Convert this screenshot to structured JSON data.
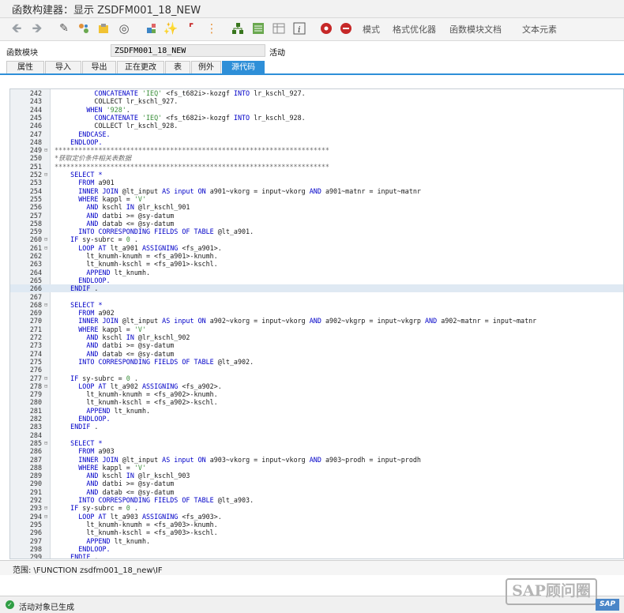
{
  "window": {
    "title": "函数构建器：显示 ZSDFM001_18_NEW"
  },
  "toolbar": {
    "icons": [
      "back-arrow-icon",
      "forward-arrow-icon",
      "other-object-icon",
      "switch-display-change-icon",
      "active-inactive-icon",
      "check-icon",
      "activate-icon",
      "test-icon",
      "where-used-icon",
      "display-object-list-icon",
      "navigation-window-icon",
      "pattern-icon",
      "insert-icon",
      "info-icon",
      "breakpoint-icon",
      "session-breakpoint-icon"
    ],
    "text_buttons": [
      "模式",
      "格式优化器",
      "函数模块文档",
      "文本元素"
    ],
    "colors": {
      "breakpoint": "#c62828",
      "accent": "#2e8fd8"
    }
  },
  "field": {
    "label": "函数模块",
    "value": "ZSDFM001_18_NEW",
    "status": "活动"
  },
  "tabs": [
    "属性",
    "导入",
    "导出",
    "正在更改",
    "表",
    "例外",
    "源代码"
  ],
  "active_tab": "源代码",
  "code": {
    "current_line": 266,
    "lines": [
      {
        "n": "242",
        "t": [
          [
            "          ",
            ""
          ],
          [
            "CONCATENATE",
            "kw"
          ],
          [
            " ",
            ""
          ],
          [
            "'IEQ'",
            "st"
          ],
          [
            " <fs_t682i>-kozgf ",
            ""
          ],
          [
            "INTO",
            "kw"
          ],
          [
            " lr_kschl_927.",
            ""
          ]
        ]
      },
      {
        "n": "243",
        "t": [
          [
            "          COLLECT lr_kschl_927.",
            ""
          ]
        ]
      },
      {
        "n": "244",
        "t": [
          [
            "        ",
            ""
          ],
          [
            "WHEN",
            "kw"
          ],
          [
            " ",
            ""
          ],
          [
            "'928'",
            "st"
          ],
          [
            ".",
            ""
          ]
        ]
      },
      {
        "n": "245",
        "t": [
          [
            "          ",
            ""
          ],
          [
            "CONCATENATE",
            "kw"
          ],
          [
            " ",
            ""
          ],
          [
            "'IEQ'",
            "st"
          ],
          [
            " <fs_t682i>-kozgf ",
            ""
          ],
          [
            "INTO",
            "kw"
          ],
          [
            " lr_kschl_928.",
            ""
          ]
        ]
      },
      {
        "n": "246",
        "t": [
          [
            "          COLLECT lr_kschl_928.",
            ""
          ]
        ]
      },
      {
        "n": "247",
        "t": [
          [
            "      ",
            ""
          ],
          [
            "ENDCASE.",
            "kw"
          ]
        ]
      },
      {
        "n": "248",
        "t": [
          [
            "    ",
            ""
          ],
          [
            "ENDLOOP.",
            "kw"
          ]
        ]
      },
      {
        "n": "249",
        "t": [
          [
            "*********************************************************************",
            "cm"
          ]
        ],
        "fold": "⊟"
      },
      {
        "n": "250",
        "t": [
          [
            "*获取定价条件相关表数据",
            "cm"
          ]
        ]
      },
      {
        "n": "251",
        "t": [
          [
            "*********************************************************************",
            "cm"
          ]
        ]
      },
      {
        "n": "252",
        "t": [
          [
            "    ",
            ""
          ],
          [
            "SELECT *",
            "kw"
          ]
        ],
        "fold": "⊟"
      },
      {
        "n": "253",
        "t": [
          [
            "      ",
            ""
          ],
          [
            "FROM",
            "kw"
          ],
          [
            " a901",
            ""
          ]
        ]
      },
      {
        "n": "254",
        "t": [
          [
            "      ",
            ""
          ],
          [
            "INNER JOIN",
            "kw"
          ],
          [
            " @lt_input ",
            ""
          ],
          [
            "AS",
            "kw"
          ],
          [
            " ",
            ""
          ],
          [
            "input",
            "kw"
          ],
          [
            " ",
            ""
          ],
          [
            "ON",
            "kw"
          ],
          [
            " a901~vkorg = input~vkorg ",
            ""
          ],
          [
            "AND",
            "kw"
          ],
          [
            " a901~matnr = input~matnr",
            ""
          ]
        ]
      },
      {
        "n": "255",
        "t": [
          [
            "      ",
            ""
          ],
          [
            "WHERE",
            "kw"
          ],
          [
            " kappl = ",
            ""
          ],
          [
            "'V'",
            "st"
          ]
        ]
      },
      {
        "n": "256",
        "t": [
          [
            "        ",
            ""
          ],
          [
            "AND",
            "kw"
          ],
          [
            " kschl ",
            ""
          ],
          [
            "IN",
            "kw"
          ],
          [
            " @lr_kschl_901",
            ""
          ]
        ]
      },
      {
        "n": "257",
        "t": [
          [
            "        ",
            ""
          ],
          [
            "AND",
            "kw"
          ],
          [
            " datbi >= @sy-datum",
            ""
          ]
        ]
      },
      {
        "n": "258",
        "t": [
          [
            "        ",
            ""
          ],
          [
            "AND",
            "kw"
          ],
          [
            " datab <= @sy-datum",
            ""
          ]
        ]
      },
      {
        "n": "259",
        "t": [
          [
            "      ",
            ""
          ],
          [
            "INTO CORRESPONDING FIELDS OF TABLE",
            "kw"
          ],
          [
            " @lt_a901.",
            ""
          ]
        ]
      },
      {
        "n": "260",
        "t": [
          [
            "    ",
            ""
          ],
          [
            "IF",
            "kw"
          ],
          [
            " sy-subrc = ",
            ""
          ],
          [
            "0",
            "st"
          ],
          [
            " .",
            ""
          ]
        ],
        "fold": "⊟"
      },
      {
        "n": "261",
        "t": [
          [
            "      ",
            ""
          ],
          [
            "LOOP AT",
            "kw"
          ],
          [
            " lt_a901 ",
            ""
          ],
          [
            "ASSIGNING",
            "kw"
          ],
          [
            " <fs_a901>.",
            ""
          ]
        ],
        "fold": "⊟"
      },
      {
        "n": "262",
        "t": [
          [
            "        lt_knumh-knumh = <fs_a901>-knumh.",
            ""
          ]
        ]
      },
      {
        "n": "263",
        "t": [
          [
            "        lt_knumh-kschl = <fs_a901>-kschl.",
            ""
          ]
        ]
      },
      {
        "n": "264",
        "t": [
          [
            "        ",
            ""
          ],
          [
            "APPEND",
            "kw"
          ],
          [
            " lt_knumh.",
            ""
          ]
        ]
      },
      {
        "n": "265",
        "t": [
          [
            "      ",
            ""
          ],
          [
            "ENDLOOP.",
            "kw"
          ]
        ]
      },
      {
        "n": "266",
        "t": [
          [
            "    ",
            ""
          ],
          [
            "ENDIF",
            "kw"
          ],
          [
            " .",
            ""
          ]
        ]
      },
      {
        "n": "267",
        "t": [
          [
            "",
            ""
          ]
        ]
      },
      {
        "n": "268",
        "t": [
          [
            "    ",
            ""
          ],
          [
            "SELECT *",
            "kw"
          ]
        ],
        "fold": "⊟"
      },
      {
        "n": "269",
        "t": [
          [
            "      ",
            ""
          ],
          [
            "FROM",
            "kw"
          ],
          [
            " a902",
            ""
          ]
        ]
      },
      {
        "n": "270",
        "t": [
          [
            "      ",
            ""
          ],
          [
            "INNER JOIN",
            "kw"
          ],
          [
            " @lt_input ",
            ""
          ],
          [
            "AS",
            "kw"
          ],
          [
            " ",
            ""
          ],
          [
            "input",
            "kw"
          ],
          [
            " ",
            ""
          ],
          [
            "ON",
            "kw"
          ],
          [
            " a902~vkorg = input~vkorg ",
            ""
          ],
          [
            "AND",
            "kw"
          ],
          [
            " a902~vkgrp = input~vkgrp ",
            ""
          ],
          [
            "AND",
            "kw"
          ],
          [
            " a902~matnr = input~matnr",
            ""
          ]
        ]
      },
      {
        "n": "271",
        "t": [
          [
            "      ",
            ""
          ],
          [
            "WHERE",
            "kw"
          ],
          [
            " kappl = ",
            ""
          ],
          [
            "'V'",
            "st"
          ]
        ]
      },
      {
        "n": "272",
        "t": [
          [
            "        ",
            ""
          ],
          [
            "AND",
            "kw"
          ],
          [
            " kschl ",
            ""
          ],
          [
            "IN",
            "kw"
          ],
          [
            " @lr_kschl_902",
            ""
          ]
        ]
      },
      {
        "n": "273",
        "t": [
          [
            "        ",
            ""
          ],
          [
            "AND",
            "kw"
          ],
          [
            " datbi >= @sy-datum",
            ""
          ]
        ]
      },
      {
        "n": "274",
        "t": [
          [
            "        ",
            ""
          ],
          [
            "AND",
            "kw"
          ],
          [
            " datab <= @sy-datum",
            ""
          ]
        ]
      },
      {
        "n": "275",
        "t": [
          [
            "      ",
            ""
          ],
          [
            "INTO CORRESPONDING FIELDS OF TABLE",
            "kw"
          ],
          [
            " @lt_a902.",
            ""
          ]
        ]
      },
      {
        "n": "276",
        "t": [
          [
            "",
            ""
          ]
        ]
      },
      {
        "n": "277",
        "t": [
          [
            "    ",
            ""
          ],
          [
            "IF",
            "kw"
          ],
          [
            " sy-subrc = ",
            ""
          ],
          [
            "0",
            "st"
          ],
          [
            " .",
            ""
          ]
        ],
        "fold": "⊟"
      },
      {
        "n": "278",
        "t": [
          [
            "      ",
            ""
          ],
          [
            "LOOP AT",
            "kw"
          ],
          [
            " lt_a902 ",
            ""
          ],
          [
            "ASSIGNING",
            "kw"
          ],
          [
            " <fs_a902>.",
            ""
          ]
        ],
        "fold": "⊟"
      },
      {
        "n": "279",
        "t": [
          [
            "        lt_knumh-knumh = <fs_a902>-knumh.",
            ""
          ]
        ]
      },
      {
        "n": "280",
        "t": [
          [
            "        lt_knumh-kschl = <fs_a902>-kschl.",
            ""
          ]
        ]
      },
      {
        "n": "281",
        "t": [
          [
            "        ",
            ""
          ],
          [
            "APPEND",
            "kw"
          ],
          [
            " lt_knumh.",
            ""
          ]
        ]
      },
      {
        "n": "282",
        "t": [
          [
            "      ",
            ""
          ],
          [
            "ENDLOOP.",
            "kw"
          ]
        ]
      },
      {
        "n": "283",
        "t": [
          [
            "    ",
            ""
          ],
          [
            "ENDIF",
            "kw"
          ],
          [
            " .",
            ""
          ]
        ]
      },
      {
        "n": "284",
        "t": [
          [
            "",
            ""
          ]
        ]
      },
      {
        "n": "285",
        "t": [
          [
            "    ",
            ""
          ],
          [
            "SELECT *",
            "kw"
          ]
        ],
        "fold": "⊟"
      },
      {
        "n": "286",
        "t": [
          [
            "      ",
            ""
          ],
          [
            "FROM",
            "kw"
          ],
          [
            " a903",
            ""
          ]
        ]
      },
      {
        "n": "287",
        "t": [
          [
            "      ",
            ""
          ],
          [
            "INNER JOIN",
            "kw"
          ],
          [
            " @lt_input ",
            ""
          ],
          [
            "AS",
            "kw"
          ],
          [
            " ",
            ""
          ],
          [
            "input",
            "kw"
          ],
          [
            " ",
            ""
          ],
          [
            "ON",
            "kw"
          ],
          [
            " a903~vkorg = input~vkorg ",
            ""
          ],
          [
            "AND",
            "kw"
          ],
          [
            " a903~prodh = input~prodh",
            ""
          ]
        ]
      },
      {
        "n": "288",
        "t": [
          [
            "      ",
            ""
          ],
          [
            "WHERE",
            "kw"
          ],
          [
            " kappl = ",
            ""
          ],
          [
            "'V'",
            "st"
          ]
        ]
      },
      {
        "n": "289",
        "t": [
          [
            "        ",
            ""
          ],
          [
            "AND",
            "kw"
          ],
          [
            " kschl ",
            ""
          ],
          [
            "IN",
            "kw"
          ],
          [
            " @lr_kschl_903",
            ""
          ]
        ]
      },
      {
        "n": "290",
        "t": [
          [
            "        ",
            ""
          ],
          [
            "AND",
            "kw"
          ],
          [
            " datbi >= @sy-datum",
            ""
          ]
        ]
      },
      {
        "n": "291",
        "t": [
          [
            "        ",
            ""
          ],
          [
            "AND",
            "kw"
          ],
          [
            " datab <= @sy-datum",
            ""
          ]
        ]
      },
      {
        "n": "292",
        "t": [
          [
            "      ",
            ""
          ],
          [
            "INTO CORRESPONDING FIELDS OF TABLE",
            "kw"
          ],
          [
            " @lt_a903.",
            ""
          ]
        ]
      },
      {
        "n": "293",
        "t": [
          [
            "    ",
            ""
          ],
          [
            "IF",
            "kw"
          ],
          [
            " sy-subrc = ",
            ""
          ],
          [
            "0",
            "st"
          ],
          [
            " .",
            ""
          ]
        ],
        "fold": "⊟"
      },
      {
        "n": "294",
        "t": [
          [
            "      ",
            ""
          ],
          [
            "LOOP AT",
            "kw"
          ],
          [
            " lt_a903 ",
            ""
          ],
          [
            "ASSIGNING",
            "kw"
          ],
          [
            " <fs_a903>.",
            ""
          ]
        ],
        "fold": "⊟"
      },
      {
        "n": "295",
        "t": [
          [
            "        lt_knumh-knumh = <fs_a903>-knumh.",
            ""
          ]
        ]
      },
      {
        "n": "296",
        "t": [
          [
            "        lt_knumh-kschl = <fs_a903>-kschl.",
            ""
          ]
        ]
      },
      {
        "n": "297",
        "t": [
          [
            "        ",
            ""
          ],
          [
            "APPEND",
            "kw"
          ],
          [
            " lt_knumh.",
            ""
          ]
        ]
      },
      {
        "n": "298",
        "t": [
          [
            "      ",
            ""
          ],
          [
            "ENDLOOP.",
            "kw"
          ]
        ]
      },
      {
        "n": "299",
        "t": [
          [
            "    ",
            ""
          ],
          [
            "ENDIF",
            "kw"
          ],
          [
            " .",
            ""
          ]
        ]
      }
    ]
  },
  "scope": "范围:  \\FUNCTION zsdfm001_18_new\\IF",
  "status": {
    "message": "活动对象已生成"
  },
  "watermark": "SAP顾问圈",
  "sap_logo": "SAP"
}
